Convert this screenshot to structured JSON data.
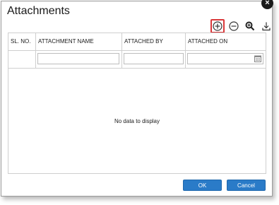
{
  "dialog": {
    "title": "Attachments",
    "close_glyph": "×"
  },
  "toolbar": {
    "icons": [
      "add-icon",
      "remove-icon",
      "zoom-icon",
      "download-icon"
    ]
  },
  "table": {
    "columns": [
      "SL. NO.",
      "ATTACHMENT NAME",
      "ATTACHED BY",
      "ATTACHED ON"
    ],
    "filters": {
      "attachment_name": "",
      "attached_by": "",
      "attached_on": ""
    },
    "empty_text": "No data to display"
  },
  "buttons": {
    "ok": "OK",
    "cancel": "Cancel"
  },
  "colors": {
    "primary": "#2a7bc8",
    "highlight": "#d9383a"
  }
}
